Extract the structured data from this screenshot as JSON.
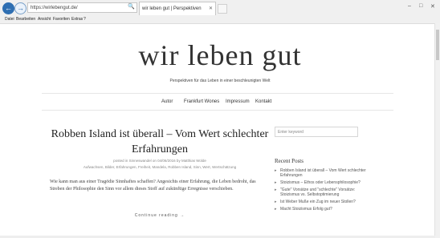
{
  "browser": {
    "nav_back": "←",
    "nav_forward": "→",
    "address": "https://wirlebengut.de/",
    "address_tools": "🔍 ▾ ✕ ↻",
    "tab_title": "wir leben gut | Perspektiven",
    "tab_close": "✕",
    "window_controls": {
      "minimize": "–",
      "maximize": "□",
      "close": "✕"
    },
    "menu": [
      "Datei",
      "Bearbeiten",
      "Ansicht",
      "Favoriten",
      "Extras",
      "?"
    ]
  },
  "site": {
    "title": "wir leben gut",
    "tagline": "Perspektiven für das Leben in einer beschleunigten Welt"
  },
  "nav": [
    "Autor",
    "Frankfurt Wones",
    "Impressum",
    "Kontakt"
  ],
  "post": {
    "title": "Robben Island ist überall – Vom Wert schlechter Erfahrungen",
    "meta_line1": "posted in Sinneswandel on 04/06/2016 by Matthias Wolde",
    "meta_line2": "Aufwachsen, Bilder, Erfahrungen, Freiheit, Mandela, Robben Island, Sinn, Wert, Wertschätzung",
    "excerpt": "Wie kann man aus einer Tragödie Sinnhaftes schaffen? Angesichts einer Erfahrung, die Leben bedroht, das Streben der Philosophie den Sinn vor allem dieses Stoff auf zukünftige Erregnisse verschieben.",
    "read_more": "Continue reading →"
  },
  "sidebar": {
    "search_placeholder": "Enter keyword",
    "recent_heading": "Recent Posts",
    "recent_bullet": "▸",
    "recent_posts": [
      "Robben Island ist überall – Vom Wert schlechter Erfahrungen",
      "Stoizismus – Ethos oder Lebensphilosophie?",
      "\"Gute\" Vorsätze und \"schlechte\" Vorsätze: Stoizismus vs. Selbstoptimierung",
      "Ist Weber Muße ein Zug im neuer Stollen?",
      "Macht Stoizismus Erfolg gut?"
    ]
  }
}
